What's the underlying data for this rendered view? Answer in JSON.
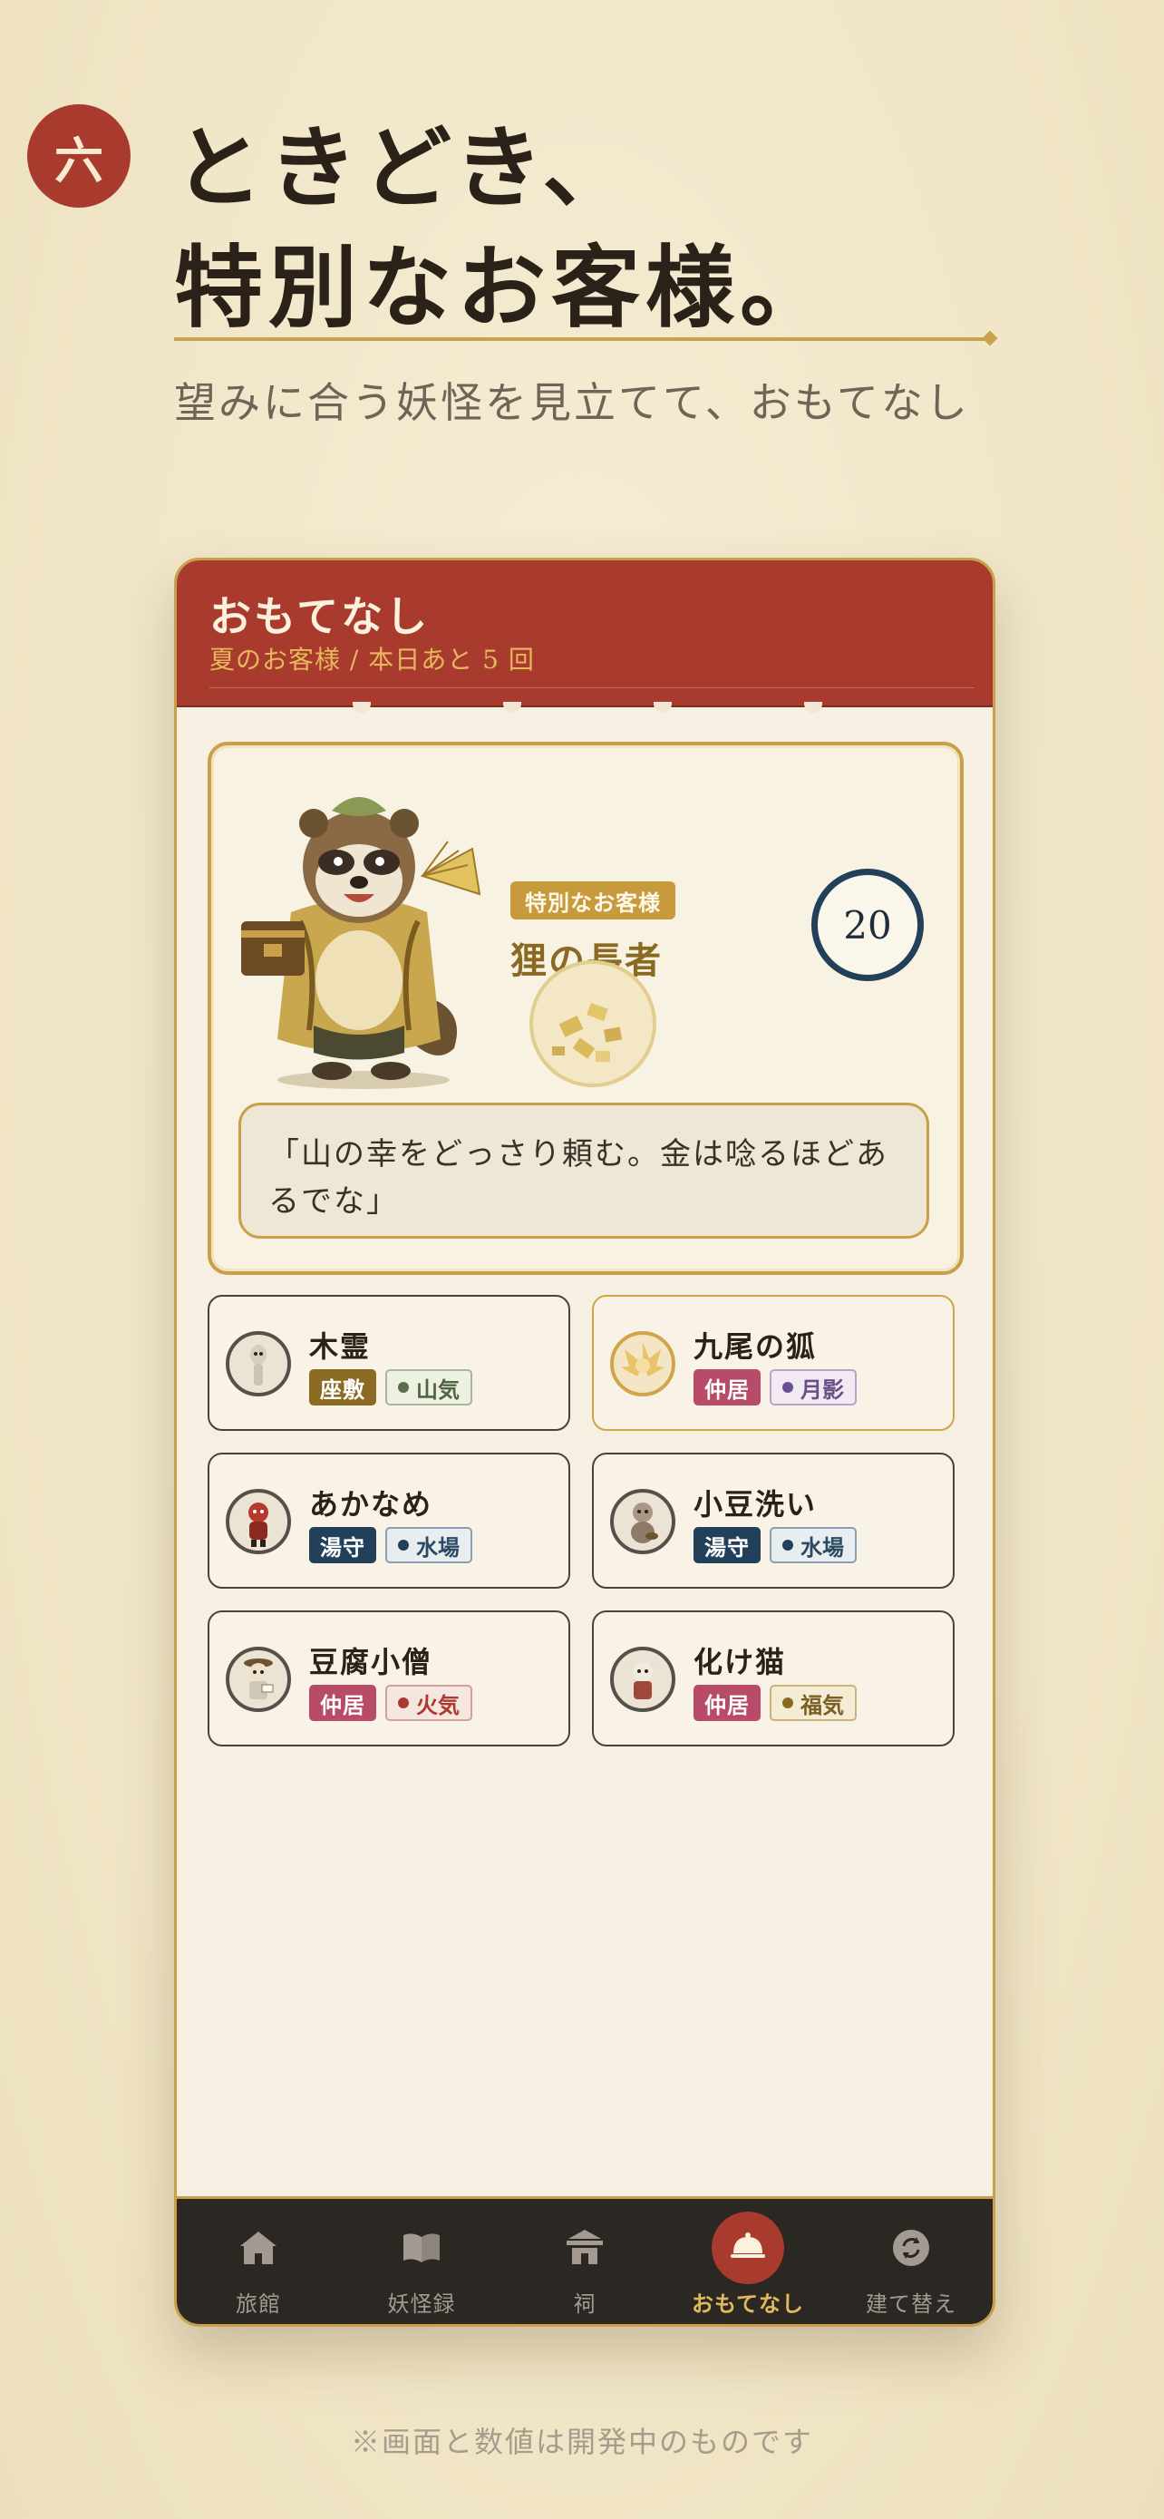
{
  "promo": {
    "number": "六",
    "headline_line1": "ときどき、",
    "headline_line2": "特別なお客様。",
    "subline": "望みに合う妖怪を見立てて、おもてなし"
  },
  "app": {
    "title": "おもてなし",
    "subtitle": "夏のお客様 / 本日あと 5 回"
  },
  "guest": {
    "tag": "特別なお客様",
    "name": "狸の長者",
    "score": "20",
    "quote": "「山の幸をどっさり頼む。金は唸るほどあるでな」"
  },
  "yokai": [
    {
      "name": "木霊",
      "role": "座敷",
      "element": "山気"
    },
    {
      "name": "九尾の狐",
      "role": "仲居",
      "element": "月影"
    },
    {
      "name": "あかなめ",
      "role": "湯守",
      "element": "水場"
    },
    {
      "name": "小豆洗い",
      "role": "湯守",
      "element": "水場"
    },
    {
      "name": "豆腐小僧",
      "role": "仲居",
      "element": "火気"
    },
    {
      "name": "化け猫",
      "role": "仲居",
      "element": "福気"
    }
  ],
  "tabs": [
    {
      "label": "旅館",
      "icon": "ryokan-icon"
    },
    {
      "label": "妖怪録",
      "icon": "book-icon"
    },
    {
      "label": "祠",
      "icon": "shrine-icon"
    },
    {
      "label": "おもてなし",
      "icon": "service-bell-icon",
      "active": true
    },
    {
      "label": "建て替え",
      "icon": "rebuild-icon"
    }
  ],
  "footnote": "※画面と数値は開発中のものです",
  "colors": {
    "crimson": "#a93a2e",
    "gold": "#c9a04a",
    "navy": "#23405a",
    "paper": "#f1e6c8"
  }
}
